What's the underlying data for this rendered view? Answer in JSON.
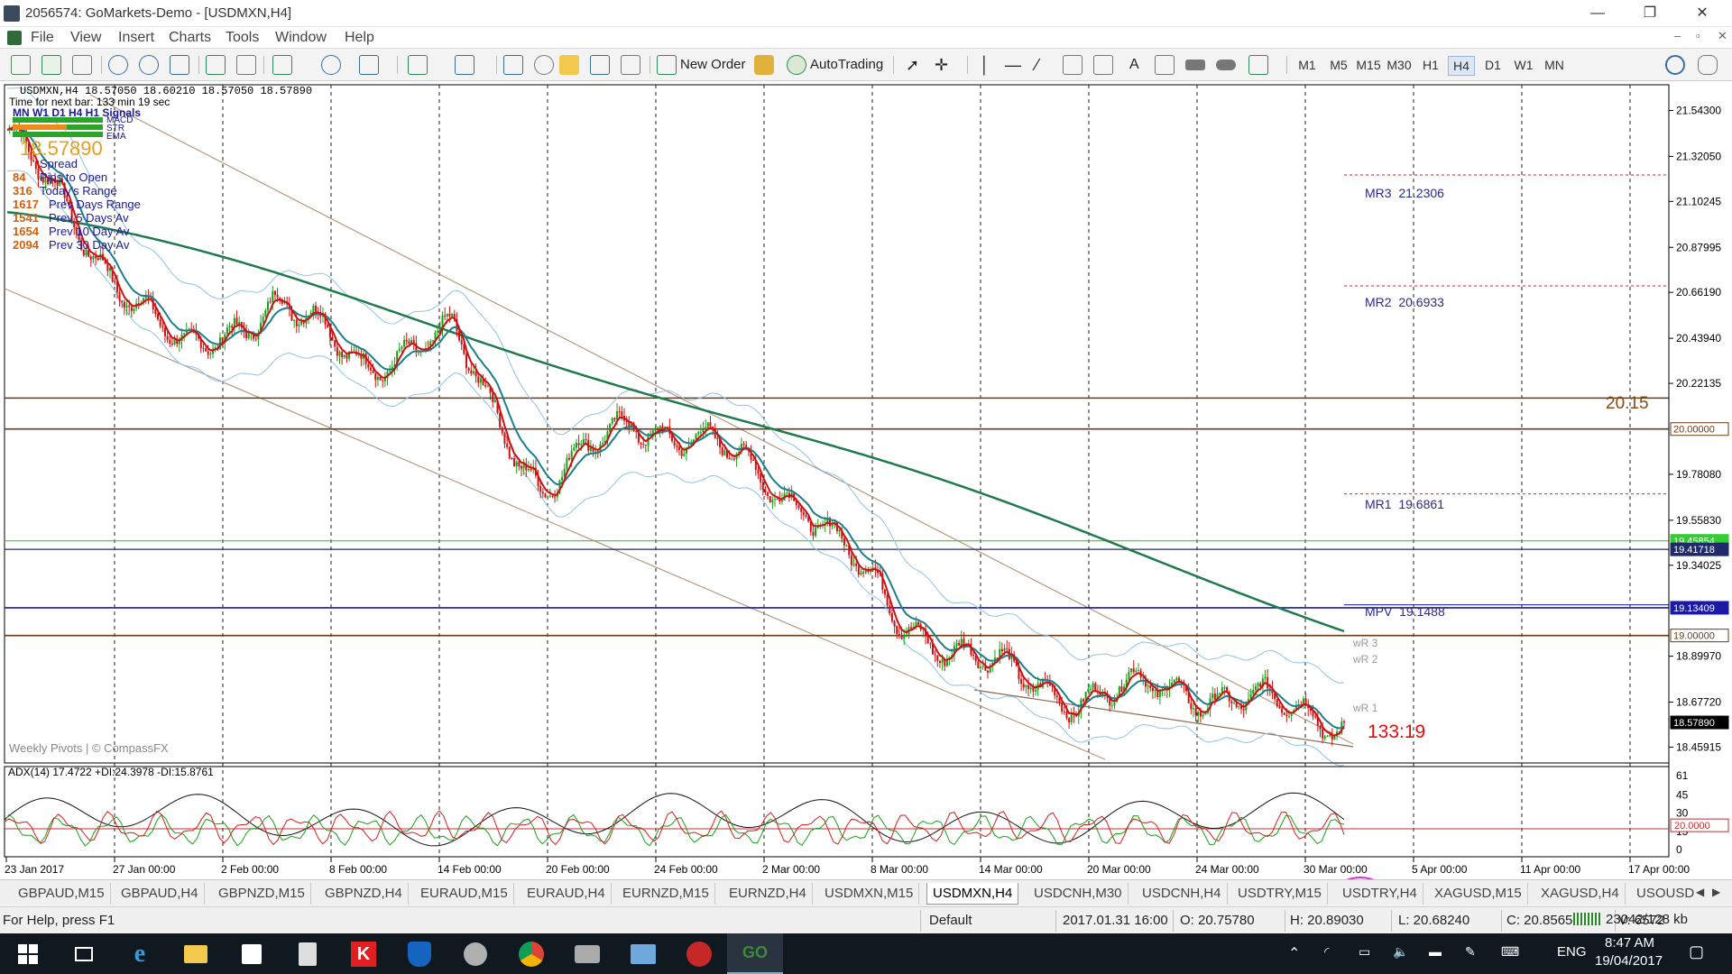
{
  "window": {
    "title": "2056574: GoMarkets-Demo - [USDMXN,H4]",
    "controls": [
      "—",
      "❐",
      "✕"
    ]
  },
  "menu": {
    "items": [
      "File",
      "View",
      "Insert",
      "Charts",
      "Tools",
      "Window",
      "Help"
    ],
    "mdi_controls": [
      "–",
      "▫",
      "✕"
    ]
  },
  "toolbar": {
    "new_order_label": "New Order",
    "autotrading_label": "AutoTrading",
    "timeframes": [
      "M1",
      "M5",
      "M15",
      "M30",
      "H1",
      "H4",
      "D1",
      "W1",
      "MN"
    ],
    "active_timeframe": "H4"
  },
  "chart": {
    "symbol_line": "USDMXN,H4  18.57050 18.60210 18.57050 18.57890",
    "next_bar_line": "Time for next bar: 133 min 19 sec",
    "signals_header": "MN W1 D1  H4  H1   Signals",
    "signal_labels": [
      "MACD",
      "STR",
      "EMA"
    ],
    "big_price": "18.57890",
    "stats": [
      {
        "value": "",
        "label": "Spread"
      },
      {
        "value": "84",
        "label": "Pips to Open"
      },
      {
        "value": "316",
        "label": "Today's Range"
      },
      {
        "value": "1617",
        "label": "Prev Days Range"
      },
      {
        "value": "1541",
        "label": "Prev 5 Days Av"
      },
      {
        "value": "1654",
        "label": "Prev 10 Day Av"
      },
      {
        "value": "2094",
        "label": "Prev 30 Day Av"
      }
    ],
    "watermark": "Weekly Pivots | © CompassFX",
    "countdown": "133:19",
    "level_2015_label": "20.15",
    "pivots": [
      {
        "label": "MR3",
        "value": "21.2306"
      },
      {
        "label": "MR2",
        "value": "20.6933"
      },
      {
        "label": "MR1",
        "value": "19.6861"
      },
      {
        "label": "MPV",
        "value": "19.1488"
      },
      {
        "label": "wR 3",
        "value": ""
      },
      {
        "label": "wR 2",
        "value": ""
      },
      {
        "label": "wR 1",
        "value": ""
      }
    ],
    "price_axis": [
      "21.54300",
      "21.32050",
      "21.10245",
      "20.87995",
      "20.66190",
      "20.43940",
      "20.22135",
      "19.78080",
      "19.55830",
      "19.34025",
      "18.89970",
      "18.67720",
      "18.45915"
    ],
    "price_tags": [
      {
        "text": "20.00000",
        "bg": "#ffffff",
        "fg": "#6b3a10",
        "border": "#6b3a10"
      },
      {
        "text": "19.45854",
        "bg": "#33cc33",
        "fg": "#ffffff",
        "border": "#33cc33"
      },
      {
        "text": "19.41718",
        "bg": "#1f2a6b",
        "fg": "#ffffff",
        "border": "#1f2a6b"
      },
      {
        "text": "19.13409",
        "bg": "#1a1aa6",
        "fg": "#ffffff",
        "border": "#1a1aa6"
      },
      {
        "text": "19.00000",
        "bg": "#ffffff",
        "fg": "#6b3a10",
        "border": "#6b3a10"
      },
      {
        "text": "18.57890",
        "bg": "#000000",
        "fg": "#ffffff",
        "border": "#000000"
      }
    ],
    "date_axis": [
      "23 Jan 2017",
      "27 Jan 00:00",
      "2 Feb 00:00",
      "8 Feb 00:00",
      "14 Feb 00:00",
      "20 Feb 00:00",
      "24 Feb 00:00",
      "2 Mar 00:00",
      "8 Mar 00:00",
      "14 Mar 00:00",
      "20 Mar 00:00",
      "24 Mar 00:00",
      "30 Mar 00:00",
      "5 Apr 00:00",
      "11 Apr 00:00",
      "17 Apr 00:00"
    ],
    "adx": {
      "header": "ADX(14) 17.4722 +DI:24.3978 -DI:15.8761",
      "axis": [
        "61",
        "45",
        "30",
        "15",
        "0"
      ],
      "level_tag": "20.0000"
    }
  },
  "chart_data": {
    "type": "line",
    "title": "USDMXN,H4",
    "x": [
      "23 Jan 2017",
      "27 Jan",
      "2 Feb",
      "8 Feb",
      "14 Feb",
      "20 Feb",
      "24 Feb",
      "2 Mar",
      "8 Mar",
      "14 Mar",
      "20 Mar",
      "24 Mar",
      "30 Mar",
      "5 Apr",
      "11 Apr",
      "17 Apr"
    ],
    "series": [
      {
        "values": [
          21.45,
          20.85,
          20.35,
          20.62,
          20.32,
          20.45,
          19.7,
          20.05,
          19.9,
          19.62,
          19.08,
          18.85,
          18.7,
          18.75,
          18.68,
          18.58
        ]
      }
    ],
    "ylim": [
      18.4,
      21.65
    ],
    "horizontal_levels": [
      20.15,
      20.0,
      19.45854,
      19.41718,
      19.13409,
      19.0
    ],
    "grid": true
  },
  "tabs": {
    "items": [
      "GBPAUD,M15",
      "GBPAUD,H4",
      "GBPNZD,M15",
      "GBPNZD,H4",
      "EURAUD,M15",
      "EURAUD,H4",
      "EURNZD,M15",
      "EURNZD,H4",
      "USDMXN,M15",
      "USDMXN,H4",
      "USDCNH,M30",
      "USDCNH,H4",
      "USDTRY,M15",
      "USDTRY,H4",
      "XAGUSD,M15",
      "XAGUSD,H4",
      "USOUSD"
    ],
    "active": "USDMXN,H4"
  },
  "status": {
    "help": "For Help, press F1",
    "profile": "Default",
    "datetime": "2017.01.31 16:00",
    "open": "O: 20.75780",
    "high": "H: 20.89030",
    "low": "L: 20.68240",
    "close": "C: 20.85650",
    "volume": "V: 6572",
    "traffic": "23042/128 kb"
  },
  "taskbar": {
    "lang": "ENG",
    "time": "8:47 AM",
    "date": "19/04/2017"
  }
}
